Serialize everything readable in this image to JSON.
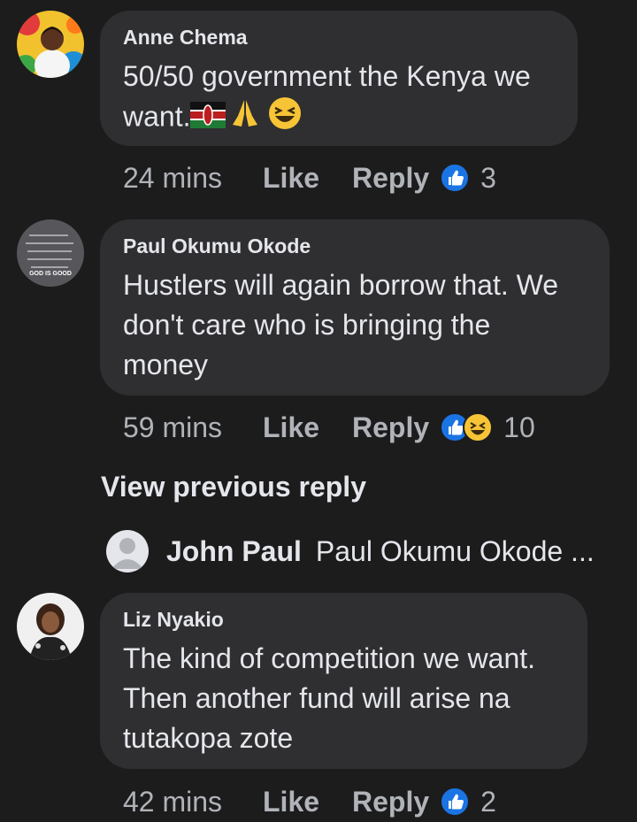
{
  "comments": [
    {
      "author": "Anne Chema",
      "text_line1": "50/50 government the Kenya we",
      "text_line2": "want.",
      "time": "24 mins",
      "like": "Like",
      "reply": "Reply",
      "reactions": [
        "like-icon"
      ],
      "count": "3"
    },
    {
      "author": "Paul Okumu Okode",
      "text_line1": "Hustlers will again borrow that. We",
      "text_line2": "don't care who is bringing the",
      "text_line3": "money",
      "avatar_text": "GOD IS GOOD",
      "time": "59 mins",
      "like": "Like",
      "reply": "Reply",
      "reactions": [
        "like-icon",
        "haha-icon"
      ],
      "count": "10"
    },
    {
      "author": "Liz Nyakio",
      "text_line1": "The kind of competition we want.",
      "text_line2": "Then another fund will arise na",
      "text_line3": "tutakopa zote",
      "time": "42 mins",
      "like": "Like",
      "reply": "Reply",
      "reactions": [
        "like-icon"
      ],
      "count": "2"
    }
  ],
  "view_previous": "View previous reply",
  "nested_reply": {
    "author": "John Paul",
    "text": "Paul Okumu Okode ..."
  },
  "colors": {
    "background": "#1c1c1d",
    "bubble": "#2f2f31",
    "like_blue": "#1b74e4",
    "secondary_text": "#b0b3b8"
  }
}
